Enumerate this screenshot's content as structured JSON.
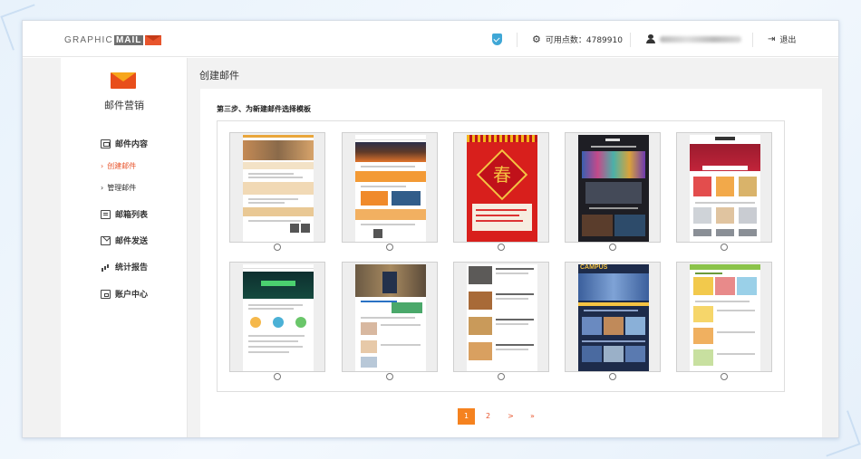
{
  "header": {
    "logo_text": "GRAPHIC",
    "logo_mail": "MAIL",
    "points_label": "可用点数：4789910",
    "exit_label": "退出"
  },
  "sidebar": {
    "title": "邮件营销",
    "items": [
      {
        "label": "邮件内容",
        "icon": "content-icon"
      },
      {
        "label": "创建邮件",
        "sub": true,
        "active": true
      },
      {
        "label": "管理邮件",
        "sub": true
      },
      {
        "label": "邮箱列表",
        "icon": "list-icon"
      },
      {
        "label": "邮件发送",
        "icon": "send-mail-icon"
      },
      {
        "label": "统计报告",
        "icon": "bar-chart-icon"
      },
      {
        "label": "账户中心",
        "icon": "wallet-icon"
      }
    ]
  },
  "main": {
    "page_title": "创建邮件",
    "step_title": "第三步、为新建邮件选择模板",
    "templates": [
      {
        "thumb": "春"
      },
      {
        "thumb": "CAMPUS"
      }
    ],
    "pagination": [
      "1",
      "2",
      ">",
      "»"
    ],
    "current_page": "1"
  },
  "colors": {
    "accent": "#f5821f",
    "brand_red": "#e84e1b"
  }
}
